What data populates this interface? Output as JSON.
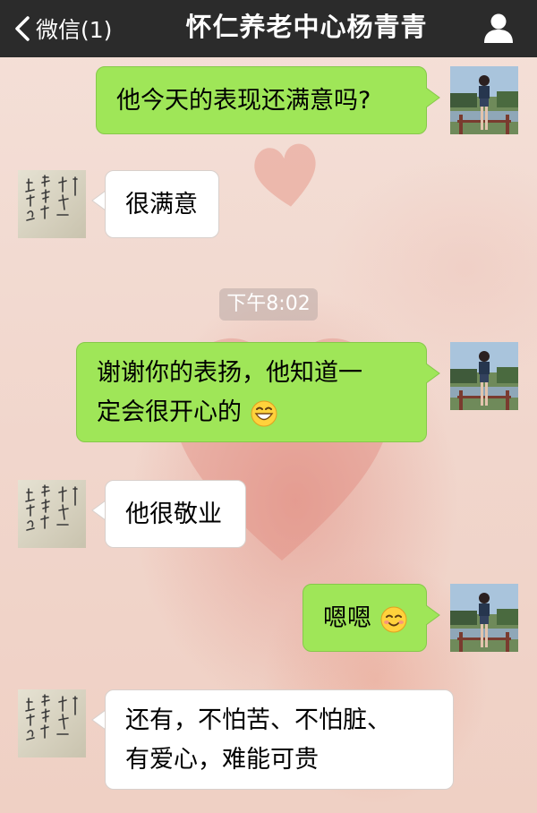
{
  "header": {
    "back_label": "微信(1)",
    "title": "怀仁养老中心杨青青"
  },
  "messages": [
    {
      "side": "right",
      "text": "他今天的表现还满意吗?"
    },
    {
      "side": "left",
      "text": "很满意"
    },
    {
      "side": "time",
      "text": "下午8:02"
    },
    {
      "side": "right",
      "line1": "谢谢你的表扬，他知道一",
      "line2": "定会很开心的",
      "emoji": "grinning-face"
    },
    {
      "side": "left",
      "text": "他很敬业"
    },
    {
      "side": "right",
      "text": "嗯嗯",
      "emoji": "smiling-face"
    },
    {
      "side": "left",
      "line1": "还有，不怕苦、不怕脏、",
      "line2": "有爱心，难能可贵"
    }
  ],
  "colors": {
    "header_bg": "#2b2b2b",
    "sent_bubble": "#9fe658",
    "received_bubble": "#ffffff"
  }
}
